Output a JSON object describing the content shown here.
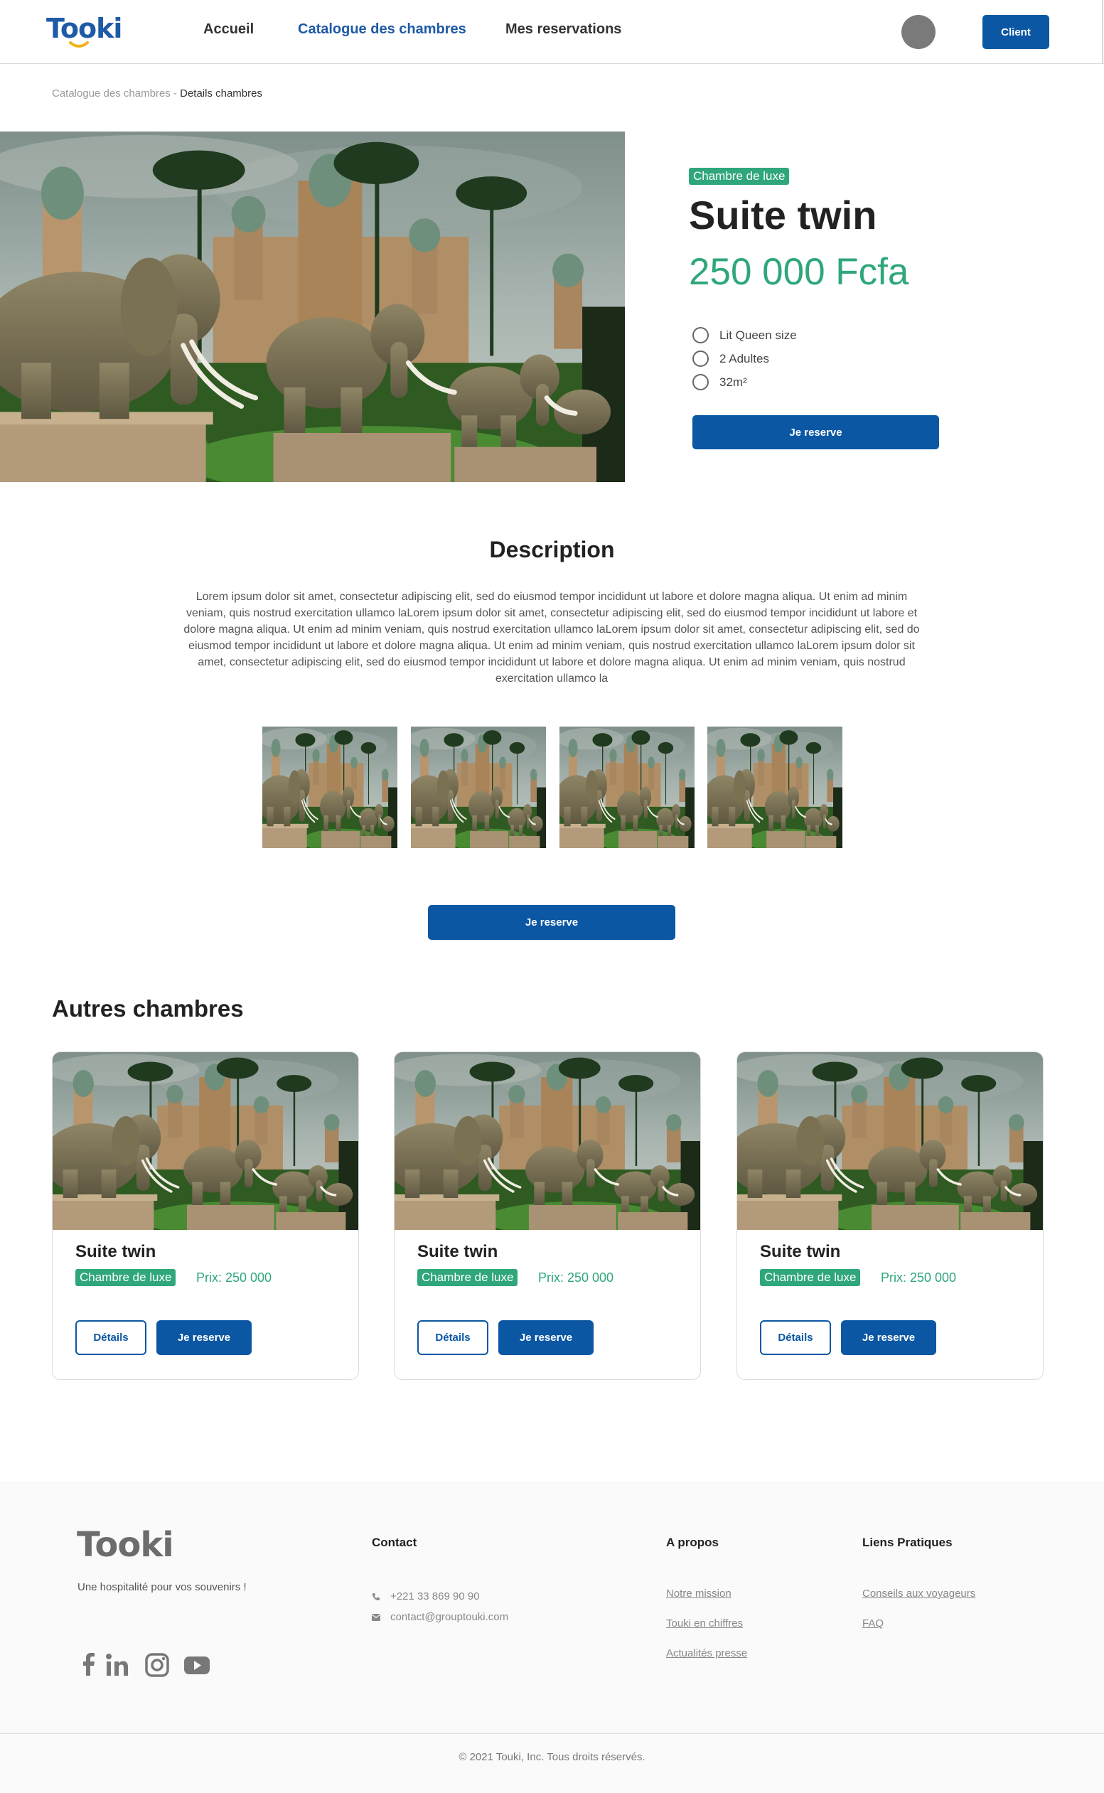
{
  "header": {
    "logo": "Tooki",
    "nav": [
      "Accueil",
      "Catalogue des chambres",
      "Mes reservations"
    ],
    "client_button": "Client"
  },
  "breadcrumb": {
    "parent": "Catalogue des chambres",
    "separator": " - ",
    "current": "Details chambres"
  },
  "room": {
    "badge": "Chambre de luxe",
    "title": "Suite twin",
    "price": "250 000 Fcfa",
    "features": [
      "Lit Queen size",
      "2 Adultes",
      "32m²"
    ],
    "reserve_button": "Je reserve"
  },
  "description": {
    "title": "Description",
    "text": "Lorem ipsum dolor sit amet, consectetur adipiscing elit, sed do eiusmod tempor incididunt ut labore et dolore magna aliqua. Ut enim ad minim veniam, quis nostrud exercitation ullamco laLorem ipsum dolor sit amet, consectetur adipiscing elit, sed do eiusmod tempor incididunt ut labore et dolore magna aliqua. Ut enim ad minim veniam, quis nostrud exercitation ullamco laLorem ipsum dolor sit amet, consectetur adipiscing elit, sed do eiusmod tempor incididunt ut labore et dolore magna aliqua. Ut enim ad minim veniam, quis nostrud exercitation ullamco laLorem ipsum dolor sit amet, consectetur adipiscing elit, sed do eiusmod tempor incididunt ut labore et dolore magna aliqua. Ut enim ad minim veniam, quis nostrud exercitation ullamco la",
    "reserve_button": "Je reserve"
  },
  "others": {
    "title": "Autres chambres",
    "cards": [
      {
        "title": "Suite twin",
        "badge": "Chambre de luxe",
        "price": "Prix: 250 000",
        "details": "Détails",
        "reserve": "Je reserve"
      },
      {
        "title": "Suite twin",
        "badge": "Chambre de luxe",
        "price": "Prix: 250 000",
        "details": "Détails",
        "reserve": "Je reserve"
      },
      {
        "title": "Suite twin",
        "badge": "Chambre de luxe",
        "price": "Prix: 250 000",
        "details": "Détails",
        "reserve": "Je reserve"
      }
    ]
  },
  "footer": {
    "logo": "Tooki",
    "tagline": "Une hospitalité pour vos souvenirs !",
    "social_icons": [
      "facebook-icon",
      "linkedin-icon",
      "instagram-icon",
      "youtube-icon"
    ],
    "contact": {
      "title": "Contact",
      "phone": "+221 33 869 90 90",
      "email": "contact@grouptouki.com"
    },
    "about": {
      "title": "A propos",
      "links": [
        "Notre mission",
        "Touki en chiffres",
        "Actualités presse"
      ]
    },
    "practical": {
      "title": "Liens Pratiques",
      "links": [
        "Conseils aux voyageurs",
        "FAQ"
      ]
    },
    "copyright": "© 2021 Touki, Inc. Tous droits réservés."
  },
  "colors": {
    "primary": "#0b57a4",
    "accent_green": "#2fa77a",
    "text_dark": "#222222"
  }
}
